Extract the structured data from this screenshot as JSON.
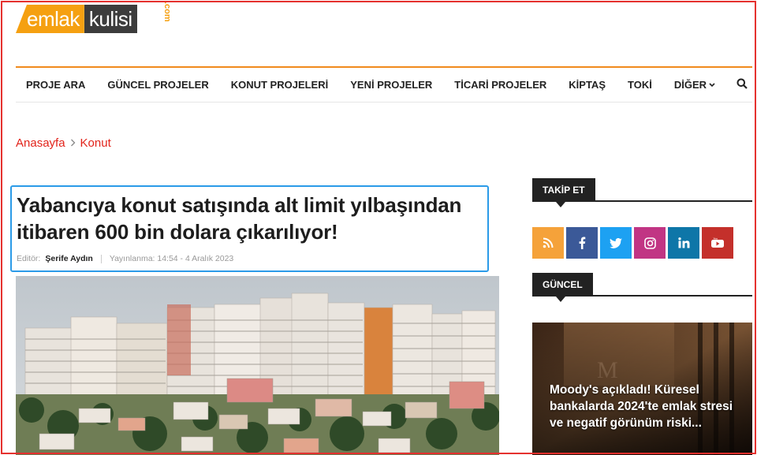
{
  "logo": {
    "left": "emlak",
    "right": "kulisi",
    "suffix": ".com"
  },
  "nav": {
    "items": [
      "PROJE ARA",
      "GÜNCEL PROJELER",
      "KONUT PROJELERİ",
      "YENİ PROJELER",
      "TİCARİ PROJELER",
      "KİPTAŞ",
      "TOKİ"
    ],
    "more": "DİĞER",
    "search_icon": "search-icon"
  },
  "breadcrumb": {
    "home": "Anasayfa",
    "current": "Konut"
  },
  "article": {
    "title": "Yabancıya konut satışında alt limit yılbaşından itibaren 600 bin dolara çıkarılıyor!",
    "editor_label": "Editör:",
    "editor_name": "Şerife Aydın",
    "published": "Yayınlanma: 14:54 - 4 Aralık 2023"
  },
  "sidebar": {
    "follow_title": "TAKİP ET",
    "socials": [
      {
        "name": "rss-icon",
        "color": "#f5a23a",
        "glyph": "))"
      },
      {
        "name": "facebook-icon",
        "color": "#3b5998",
        "glyph": "f"
      },
      {
        "name": "twitter-icon",
        "color": "#1da1f2",
        "glyph": "t"
      },
      {
        "name": "instagram-icon",
        "color": "#c13584",
        "glyph": "◎"
      },
      {
        "name": "linkedin-icon",
        "color": "#0e76a8",
        "glyph": "in"
      },
      {
        "name": "youtube-icon",
        "color": "#c4302b",
        "glyph": "▶"
      }
    ],
    "current_title": "GÜNCEL",
    "news_title": "Moody's açıkladı! Küresel bankalarda 2024'te emlak stresi ve negatif görünüm riski..."
  },
  "colors": {
    "accent": "#e2231a",
    "orange": "#f08a1c",
    "highlight": "#2b9be8"
  }
}
